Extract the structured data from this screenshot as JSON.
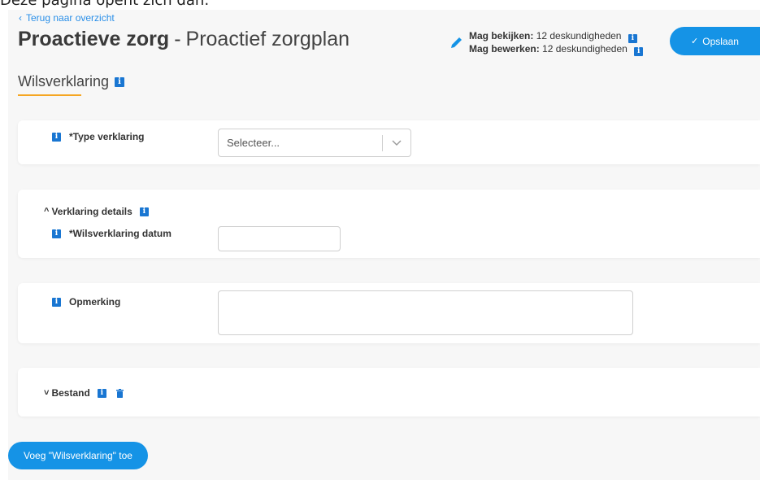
{
  "caption": "Deze pagina opent zich dan:",
  "nav": {
    "back_label": "Terug naar overzicht"
  },
  "header": {
    "title_main": "Proactieve zorg",
    "title_separator": "-",
    "title_sub": "Proactief zorgplan",
    "subtitle": "Wilsverklaring"
  },
  "permissions": {
    "view_key": "Mag bekijken:",
    "view_value": "12 deskundigheden",
    "edit_key": "Mag bewerken:",
    "edit_value": "12 deskundigheden"
  },
  "actions": {
    "save_label": "Opslaan",
    "add_label": "Voeg \"Wilsverklaring\" toe"
  },
  "form": {
    "type_label": "*Type verklaring",
    "type_placeholder": "Selecteer...",
    "details_label": "Verklaring details",
    "date_label": "*Wilsverklaring datum",
    "remark_label": "Opmerking",
    "file_label": "Bestand"
  },
  "colors": {
    "accent": "#1593e6",
    "info_icon": "#1976d2",
    "underline": "#f5a623",
    "page_bg": "#f7f7f7"
  },
  "icons": [
    "chevron-left-icon",
    "pencil-icon",
    "info-icon",
    "check-icon",
    "chevron-down-icon",
    "caret-up-icon",
    "caret-down-icon",
    "trash-icon"
  ]
}
